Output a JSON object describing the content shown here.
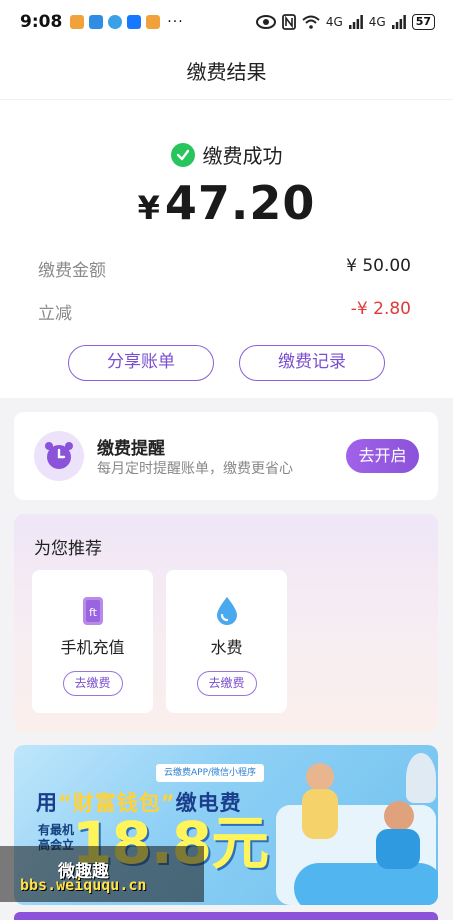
{
  "status_bar": {
    "time": "9:08",
    "more": "···",
    "network_1": "4G",
    "network_2": "4G",
    "battery": "57"
  },
  "page_title": "缴费结果",
  "result": {
    "status_text": "缴费成功",
    "currency": "¥",
    "amount": "47.20",
    "rows": [
      {
        "label": "缴费金额",
        "value": "¥ 50.00"
      },
      {
        "label": "立减",
        "value": "-¥ 2.80"
      }
    ],
    "share_button": "分享账单",
    "records_button": "缴费记录"
  },
  "reminder": {
    "title": "缴费提醒",
    "subtitle": "每月定时提醒账单，缴费更省心",
    "button": "去开启"
  },
  "recommend": {
    "title": "为您推荐",
    "items": [
      {
        "name": "手机充值",
        "button": "去缴费",
        "icon": "phone-icon"
      },
      {
        "name": "水费",
        "button": "去缴费",
        "icon": "water-drop-icon"
      }
    ]
  },
  "banner": {
    "tag": "云缴费APP/微信小程序",
    "headline_prefix": "用",
    "headline_highlight": "“财富钱包”",
    "headline_suffix": "缴电费",
    "side_text": "有最机高会立",
    "big_text": "18.8元"
  },
  "watermark": {
    "title": "微趣趣",
    "url": "bbs.weiququ.cn"
  },
  "colors": {
    "accent": "#8b52da",
    "success": "#28c45c",
    "discount": "#e03a3a"
  }
}
